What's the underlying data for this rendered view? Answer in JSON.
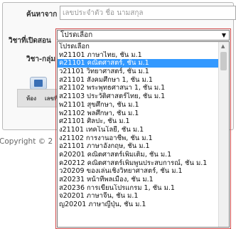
{
  "form": {
    "search_label": "ค้นหาจาก",
    "search_placeholder": "เลขประจำตัว ชื่อ นามสกุล",
    "subject_label": "วิชาที่เปิดสอน",
    "group_label": "วิชา-กลุ่ม",
    "subject_selected": "โปรดเลือก"
  },
  "table": {
    "col_room": "ห้อง",
    "col_number": "เลขที่"
  },
  "footer": {
    "copyright": "Copyright © 2"
  },
  "dropdown": {
    "options": [
      "โปรดเลือก",
      "ท21101 ภาษาไทย, ชั้น ม.1",
      "ค21101 คณิตศาสตร์, ชั้น ม.1",
      "ว21101 วิทยาศาสตร์, ชั้น ม.1",
      "ส21101 สังคมศึกษา 1, ชั้น ม.1",
      "ส21102 พระพุทธศาสนา 1, ชั้น ม.1",
      "ส21103 ประวัติศาสตร์ไทย, ชั้น ม.1",
      "พ21101 สุขศึกษา, ชั้น ม.1",
      "พ21102 พลศึกษา, ชั้น ม.1",
      "ศ21101 ศิลปะ, ชั้น ม.1",
      "ง21101 เทคโนโลยี, ชั้น ม.1",
      "ง21102 การงานอาชีพ, ชั้น ม.1",
      "อ21101 ภาษาอังกฤษ, ชั้น ม.1",
      "ค20201 คณิตศาสตร์เพิ่มเติม, ชั้น ม.1",
      "ค20212 คณิตศาสตร์เพิ่มพูนประสบการณ์, ชั้น ม.1",
      "ว20209 ของเล่นเชิงวิทยาศาสตร์, ชั้น ม.1",
      "ส20231 หน้าที่พลเมือง, ชั้น ม.1",
      "ส20236 การเขียนโปรแกรม 1, ชั้น ม.1",
      "จ20201 ภาษาจีน, ชั้น ม.1",
      "ญ20201 ภาษาญี่ปุ่น, ชั้น ม.1"
    ],
    "selected_index": 2
  },
  "colors": {
    "highlight": "#3399ff",
    "frame": "#d04b4b"
  },
  "icons": {
    "save": "floppy-disk-icon",
    "dropdown": "chevron-down-icon"
  }
}
